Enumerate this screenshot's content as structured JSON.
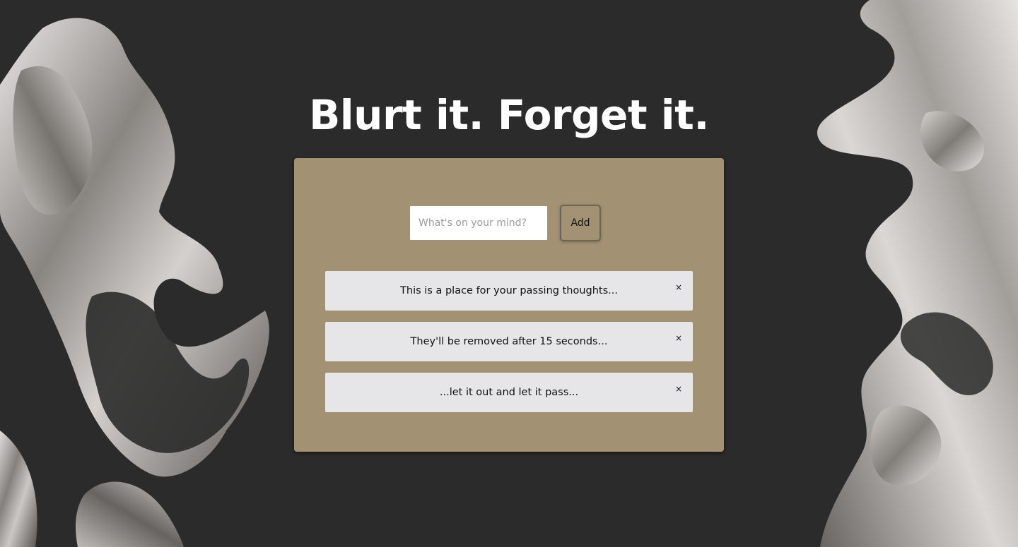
{
  "header": {
    "title": "Blurt it. Forget it."
  },
  "composer": {
    "placeholder": "What's on your mind?",
    "value": "",
    "add_label": "Add"
  },
  "thoughts": [
    {
      "text": "This is a place for your passing thoughts...",
      "close_glyph": "×"
    },
    {
      "text": "They'll be removed after 15 seconds...",
      "close_glyph": "×"
    },
    {
      "text": "...let it out and let it pass...",
      "close_glyph": "×"
    }
  ],
  "colors": {
    "background": "#2b2b2b",
    "panel": "#a29273",
    "item": "#e6e6e9",
    "title": "#ffffff",
    "chrome": "#c8c5c2"
  },
  "icons": {
    "close": "close-icon",
    "decoration": "liquid-chrome-sculpture"
  }
}
